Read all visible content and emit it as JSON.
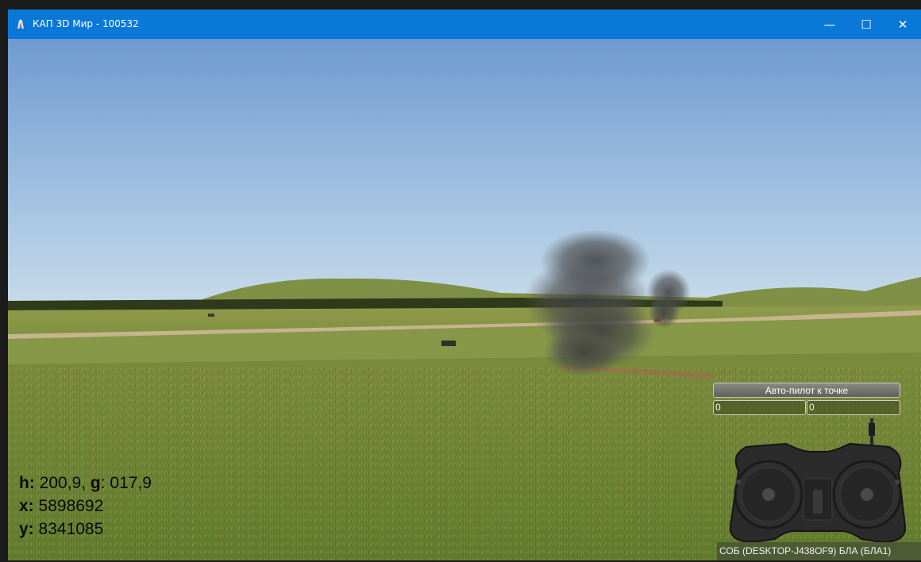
{
  "window": {
    "title": "КАП 3D Мир - 100532",
    "minimize_glyph": "—",
    "maximize_glyph": "☐",
    "close_glyph": "✕",
    "titlebar_color": "#0a78d7"
  },
  "hud": {
    "h_label": "h:",
    "h_value": "200,9,",
    "g_label": "g",
    "g_value": ": 017,9",
    "x_label": "x:",
    "x_value": "5898692",
    "y_label": "y:",
    "y_value": "8341085"
  },
  "autopilot": {
    "button_label": "Авто-пилот к точке",
    "x_value": "0",
    "y_value": "0"
  },
  "status": {
    "text": "СОБ (DESKTOP-J438OF9) БЛА (БЛА1)"
  },
  "icons": {
    "app": "app-icon",
    "controller": "rc-transmitter-icon"
  }
}
